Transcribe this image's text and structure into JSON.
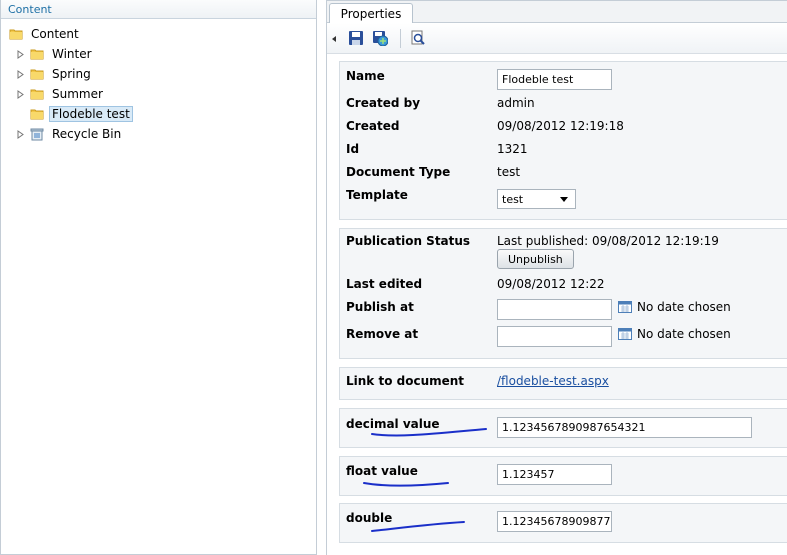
{
  "left_panel": {
    "header": "Content",
    "tree": {
      "root": "Content",
      "children": [
        {
          "label": "Winter",
          "expandable": true
        },
        {
          "label": "Spring",
          "expandable": true
        },
        {
          "label": "Summer",
          "expandable": true
        },
        {
          "label": "Flodeble test",
          "expandable": false,
          "selected": true
        },
        {
          "label": "Recycle Bin",
          "expandable": true
        }
      ]
    }
  },
  "right_panel": {
    "tab": "Properties",
    "toolbar": {
      "icons": [
        "save-icon",
        "save-and-publish-icon",
        "preview-icon"
      ]
    },
    "info": {
      "name_label": "Name",
      "name_value": "Flodeble test",
      "created_by_label": "Created by",
      "created_by_value": "admin",
      "created_label": "Created",
      "created_value": "09/08/2012 12:19:18",
      "id_label": "Id",
      "id_value": "1321",
      "doctype_label": "Document Type",
      "doctype_value": "test",
      "template_label": "Template",
      "template_value": "test"
    },
    "publication": {
      "status_label": "Publication Status",
      "status_value": "Last published: 09/08/2012 12:19:19",
      "unpublish_label": "Unpublish",
      "last_edited_label": "Last edited",
      "last_edited_value": "09/08/2012 12:22",
      "publish_at_label": "Publish at",
      "publish_at_value": "",
      "publish_at_note": "No date chosen",
      "remove_at_label": "Remove at",
      "remove_at_value": "",
      "remove_at_note": "No date chosen"
    },
    "link": {
      "label": "Link to document",
      "value": "/flodeble-test.aspx"
    },
    "decimal": {
      "label": "decimal value",
      "value": "1.1234567890987654321"
    },
    "float": {
      "label": "float value",
      "value": "1.123457"
    },
    "double": {
      "label": "double",
      "value": "1.12345678909877"
    },
    "colors": {
      "annotation_ink": "#1a2fc9",
      "link": "#1a4fa0",
      "header_text": "#1d6fa5"
    }
  }
}
